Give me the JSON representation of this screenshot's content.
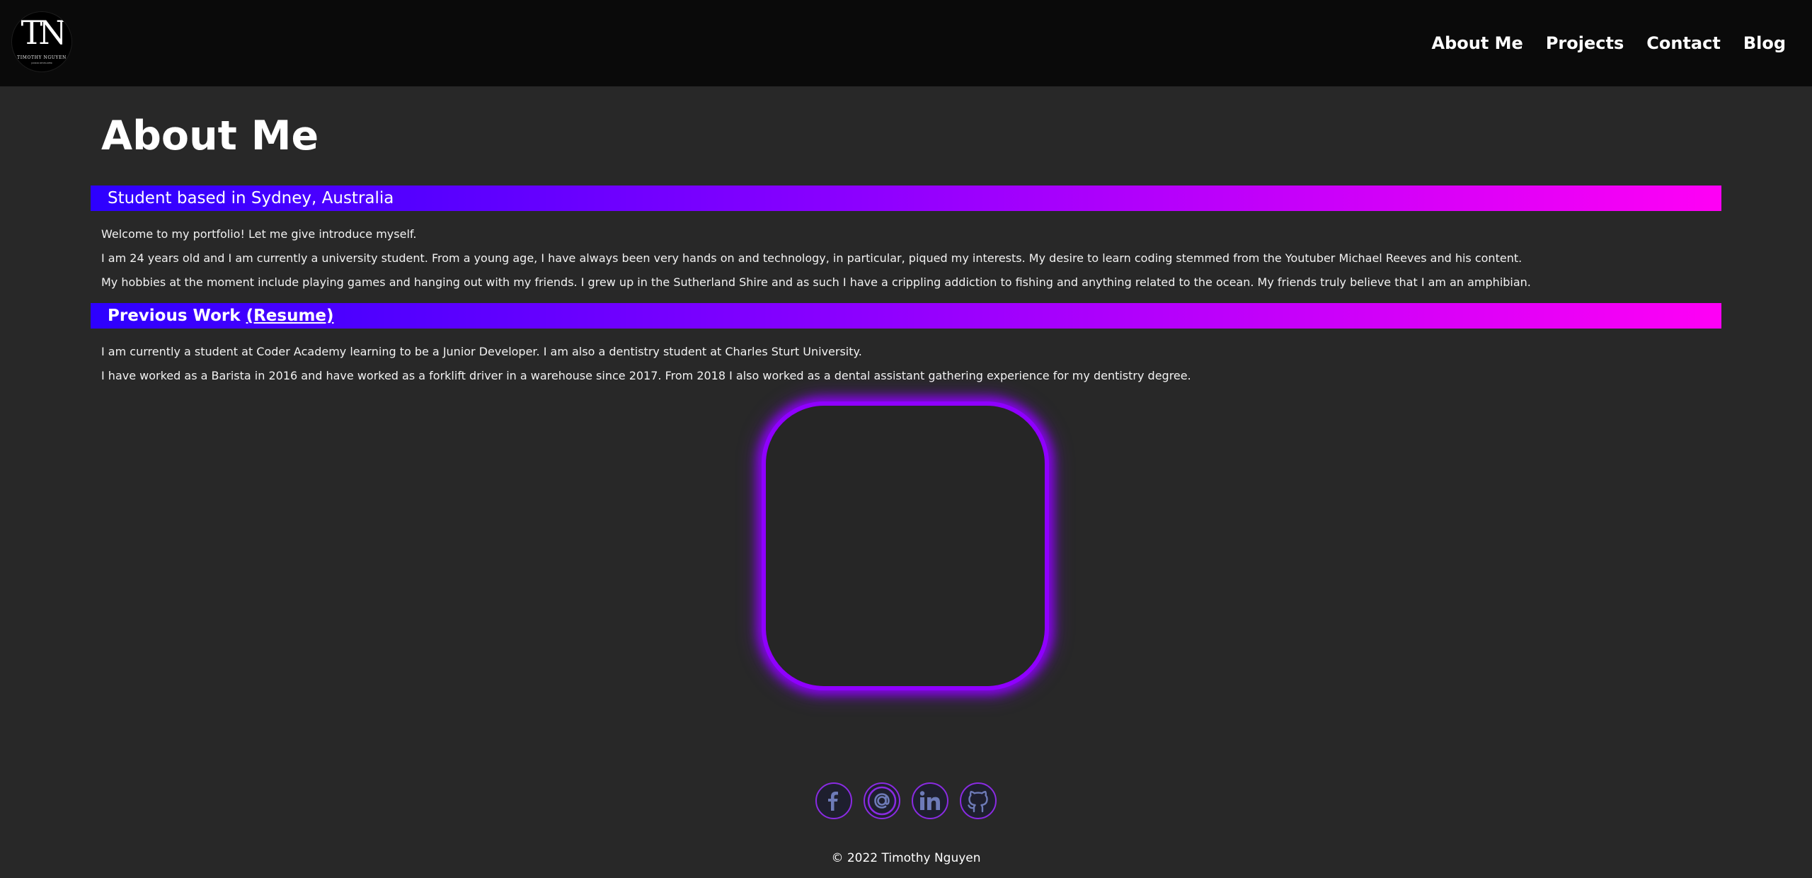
{
  "header": {
    "logo": {
      "monogram": "TN",
      "name": "TIMOTHY NGUYEN",
      "tagline": "JUNIOR DEVELOPER"
    },
    "nav": [
      {
        "label": "About Me"
      },
      {
        "label": "Projects"
      },
      {
        "label": "Contact"
      },
      {
        "label": "Blog"
      }
    ]
  },
  "main": {
    "title": "About Me",
    "section1": {
      "heading": "Student based in Sydney, Australia",
      "paragraphs": [
        "Welcome to my portfolio! Let me give introduce myself.",
        "I am 24 years old and I am currently a university student. From a young age, I have always been very hands on and technology, in particular, piqued my interests. My desire to learn coding stemmed from the Youtuber Michael Reeves and his content.",
        "My hobbies at the moment include playing games and hanging out with my friends. I grew up in the Sutherland Shire and as such I have a crippling addiction to fishing and anything related to the ocean. My friends truly believe that I am an amphibian."
      ]
    },
    "section2": {
      "heading": "Previous Work",
      "link_label": "(Resume)",
      "paragraphs": [
        "I am currently a student at Coder Academy learning to be a Junior Developer. I am also a dentistry student at Charles Sturt University.",
        "I have worked as a Barista in 2016 and have worked as a forklift driver in a warehouse since 2017. From 2018 I also worked as a dental assistant gathering experience for my dentistry degree."
      ]
    }
  },
  "socials": [
    {
      "icon": "facebook-icon"
    },
    {
      "icon": "email-icon"
    },
    {
      "icon": "linkedin-icon"
    },
    {
      "icon": "github-icon"
    }
  ],
  "footer": {
    "copyright": "© 2022 Timothy Nguyen"
  },
  "colors": {
    "background": "#282828",
    "header": "#0a0a0a",
    "gradient_start": "#2d00ff",
    "gradient_mid": "#8e00ff",
    "gradient_end": "#ff00f5",
    "accent_purple": "#8f00ff",
    "icon_fill": "#6e7bb8"
  }
}
